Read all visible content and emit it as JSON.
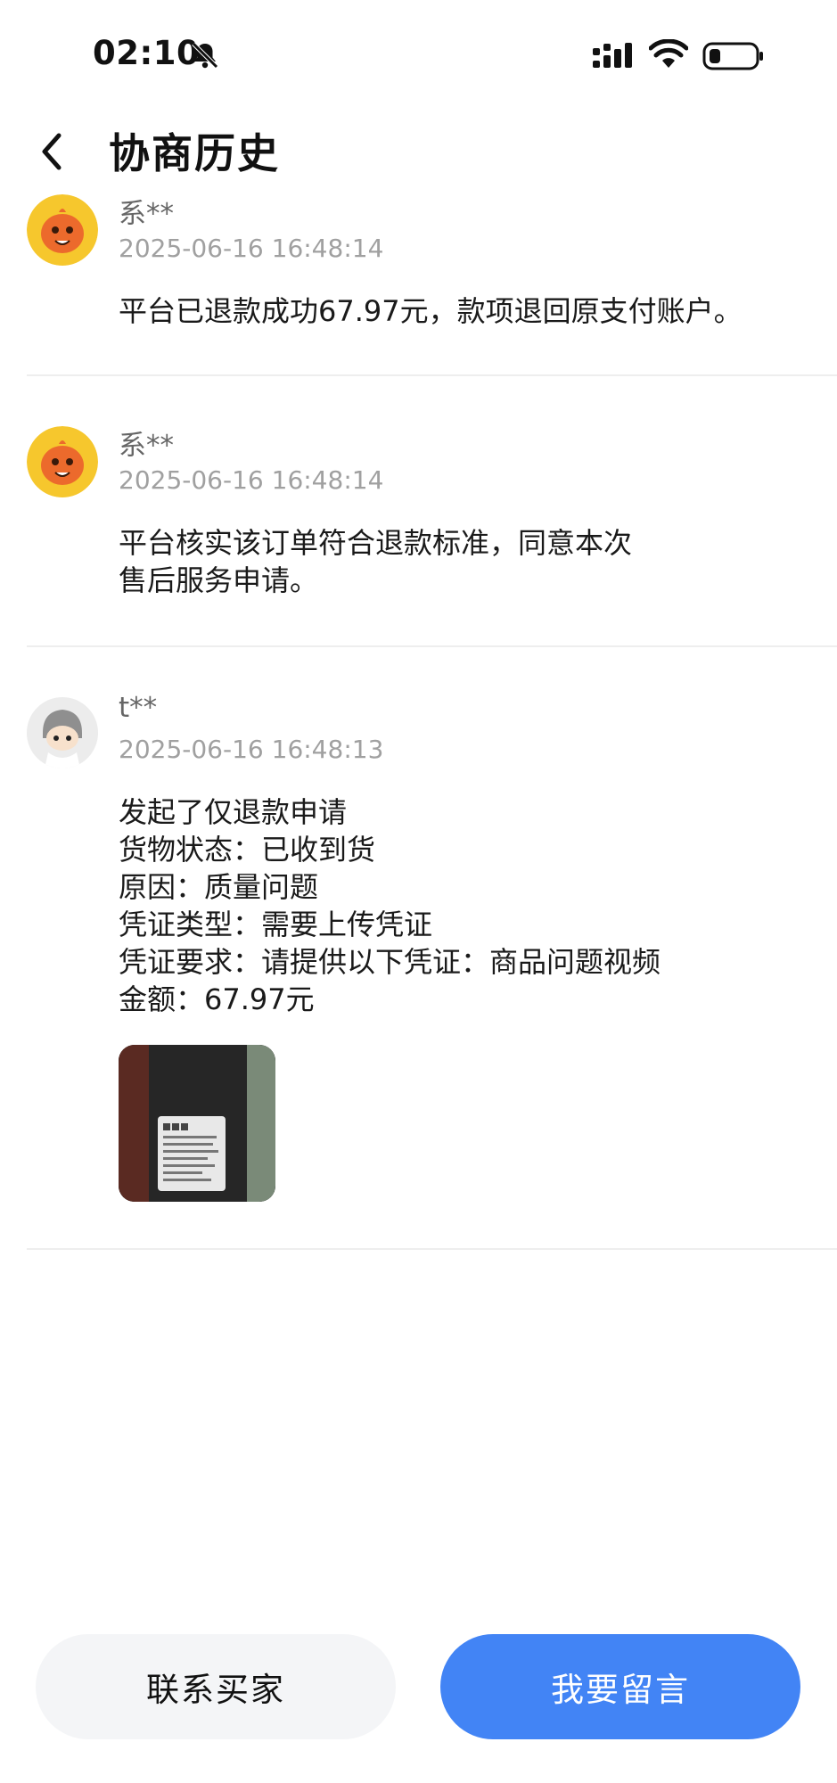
{
  "status_bar": {
    "time": "02:10",
    "icons": [
      "bell-muted-icon",
      "signal-icon",
      "wifi-icon",
      "battery-icon"
    ]
  },
  "header": {
    "title": "协商历史",
    "back_icon": "chevron-left-icon"
  },
  "records": [
    {
      "user": "系**",
      "time": "2025-06-16 16:48:14",
      "avatar": "platform-mascot-avatar",
      "lines": [
        "平台已退款成功67.97元，款项退回原支付账户。"
      ]
    },
    {
      "user": "系**",
      "time": "2025-06-16 16:48:14",
      "avatar": "platform-mascot-avatar",
      "lines": [
        "平台核实该订单符合退款标准，同意本次",
        "售后服务申请。"
      ]
    },
    {
      "user": "t**",
      "time": "2025-06-16 16:48:13",
      "avatar": "buyer-avatar",
      "lines": [
        "发起了仅退款申请",
        "货物状态：已收到货",
        "原因：质量问题",
        "凭证类型：需要上传凭证",
        "凭证要求：请提供以下凭证：商品问题视频",
        "金额：67.97元"
      ],
      "attachment": "evidence-photo"
    }
  ],
  "buttons": {
    "contact_buyer": "联系买家",
    "leave_message": "我要留言"
  },
  "colors": {
    "primary_button": "#4284f5",
    "secondary_button": "#f4f5f7",
    "timestamp": "#a0a0a0",
    "username": "#666666"
  }
}
